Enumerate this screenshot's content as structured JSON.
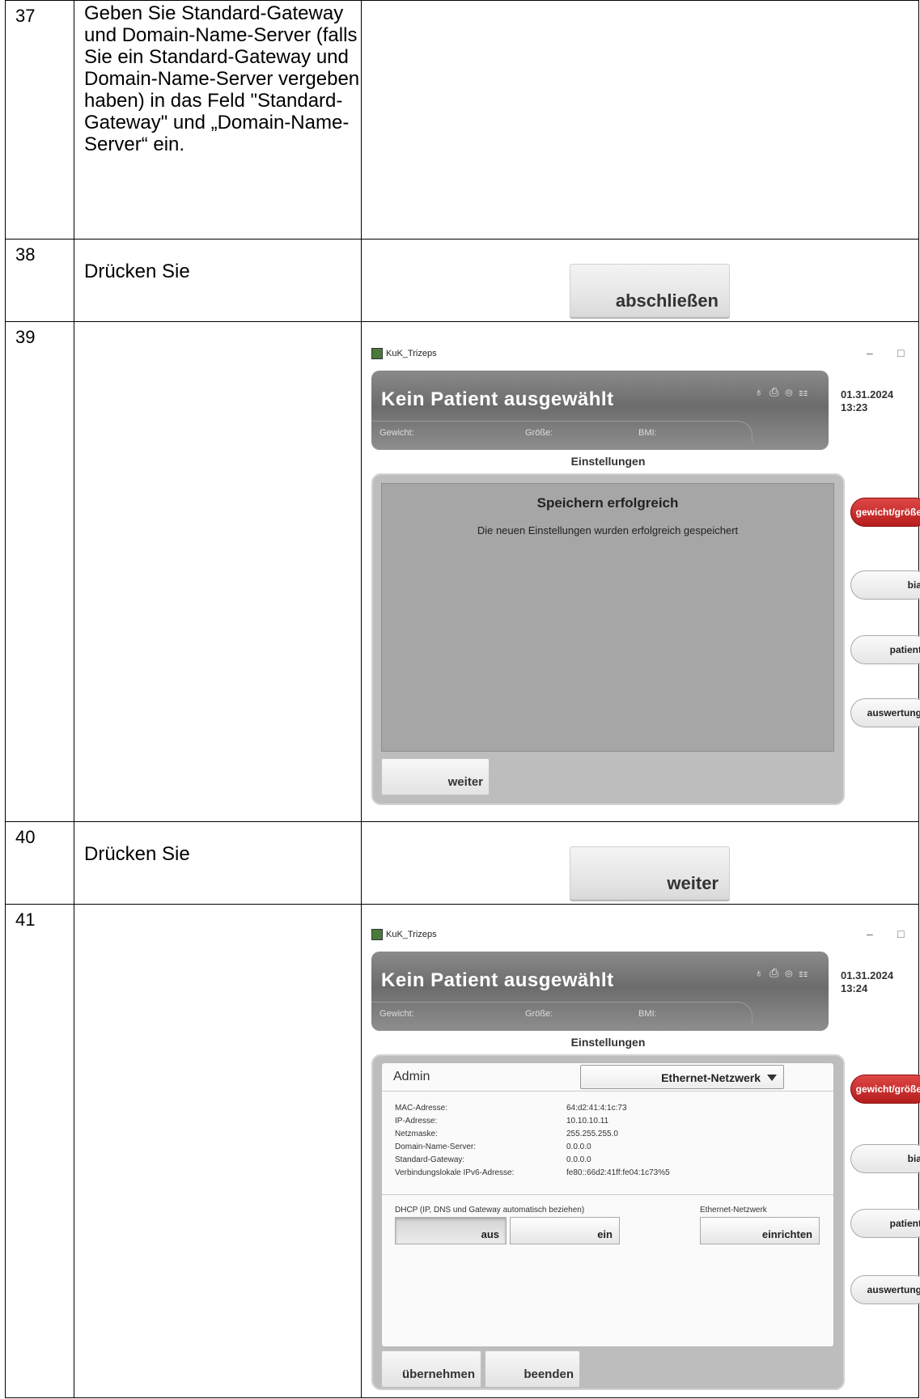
{
  "rows": [
    {
      "num": "37",
      "instruction": "Geben Sie Standard-Gateway und Domain-Name-Server (falls Sie ein Standard-Gateway und Domain-Name-Server vergeben haben) in das Feld \"Standard-Gateway\" und „Domain-Name-Server“ ein."
    },
    {
      "num": "38",
      "instruction": "Drücken Sie",
      "button_label": "abschließen"
    },
    {
      "num": "39",
      "instruction": ""
    },
    {
      "num": "40",
      "instruction": "Drücken Sie",
      "button_label": "weiter"
    },
    {
      "num": "41",
      "instruction": ""
    }
  ],
  "app": {
    "window_title": "KuK_Trizeps",
    "minimize": "–",
    "maximize": "□",
    "close": "×",
    "header_title": "Kein Patient ausgewählt",
    "weight_label": "Gewicht:",
    "height_label": "Größe:",
    "bmi_label": "BMI:",
    "page_title": "Einstellungen",
    "side_buttons": [
      "gewicht/größe",
      "bia",
      "patient",
      "auswertung"
    ]
  },
  "screen39": {
    "date": "01.31.2024",
    "time": "13:23",
    "dialog_title": "Speichern erfolgreich",
    "dialog_message": "Die neuen Einstellungen wurden erfolgreich gespeichert",
    "weiter_label": "weiter"
  },
  "screen41": {
    "date": "01.31.2024",
    "time": "13:24",
    "admin_title": "Admin",
    "dropdown_value": "Ethernet-Netzwerk",
    "fields": [
      {
        "label": "MAC-Adresse:",
        "value": "64:d2:41:4:1c:73"
      },
      {
        "label": "IP-Adresse:",
        "value": "10.10.10.11"
      },
      {
        "label": "Netzmaske:",
        "value": "255.255.255.0"
      },
      {
        "label": "Domain-Name-Server:",
        "value": "0.0.0.0"
      },
      {
        "label": "Standard-Gateway:",
        "value": "0.0.0.0"
      },
      {
        "label": "Verbindungslokale IPv6-Adresse:",
        "value": "fe80::66d2:41ff:fe04:1c73%5"
      }
    ],
    "dhcp_label": "DHCP (IP, DNS und Gateway automatisch beziehen)",
    "dhcp_off": "aus",
    "dhcp_on": "ein",
    "ethernet_label": "Ethernet-Netzwerk",
    "setup_label": "einrichten",
    "apply_label": "übernehmen",
    "exit_label": "beenden"
  }
}
